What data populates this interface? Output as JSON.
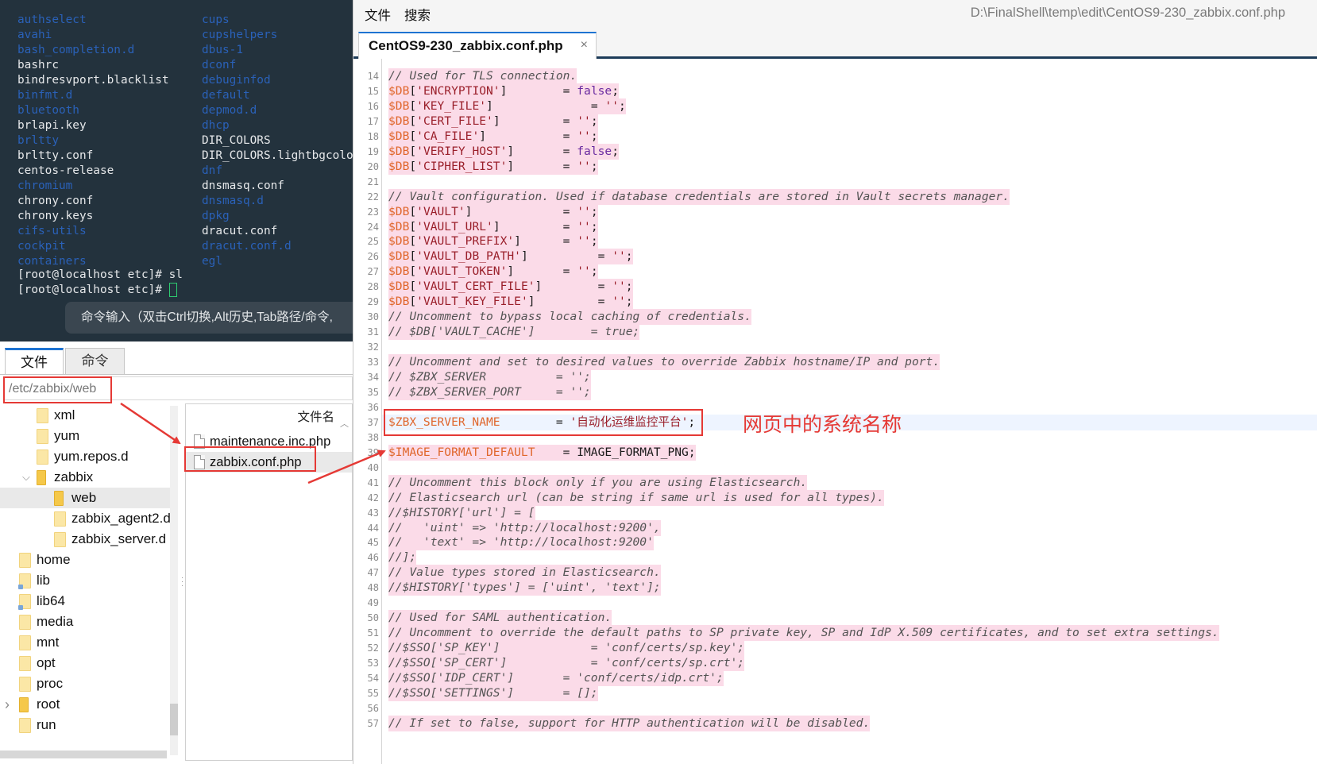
{
  "terminal": {
    "rows": [
      {
        "left": "authselect",
        "left_dir": true,
        "right": "cups",
        "right_dir": true
      },
      {
        "left": "avahi",
        "left_dir": true,
        "right": "cupshelpers",
        "right_dir": true
      },
      {
        "left": "bash_completion.d",
        "left_dir": true,
        "right": "dbus-1",
        "right_dir": true
      },
      {
        "left": "bashrc",
        "left_dir": false,
        "right": "dconf",
        "right_dir": true
      },
      {
        "left": "bindresvport.blacklist",
        "left_dir": false,
        "right": "debuginfod",
        "right_dir": true
      },
      {
        "left": "binfmt.d",
        "left_dir": true,
        "right": "default",
        "right_dir": true
      },
      {
        "left": "bluetooth",
        "left_dir": true,
        "right": "depmod.d",
        "right_dir": true
      },
      {
        "left": "brlapi.key",
        "left_dir": false,
        "right": "dhcp",
        "right_dir": true
      },
      {
        "left": "brltty",
        "left_dir": true,
        "right": "DIR_COLORS",
        "right_dir": false
      },
      {
        "left": "brltty.conf",
        "left_dir": false,
        "right": "DIR_COLORS.lightbgcolor",
        "right_dir": false
      },
      {
        "left": "centos-release",
        "left_dir": false,
        "right": "dnf",
        "right_dir": true
      },
      {
        "left": "chromium",
        "left_dir": true,
        "right": "dnsmasq.conf",
        "right_dir": false
      },
      {
        "left": "chrony.conf",
        "left_dir": false,
        "right": "dnsmasq.d",
        "right_dir": true
      },
      {
        "left": "chrony.keys",
        "left_dir": false,
        "right": "dpkg",
        "right_dir": true
      },
      {
        "left": "cifs-utils",
        "left_dir": true,
        "right": "dracut.conf",
        "right_dir": false
      },
      {
        "left": "cockpit",
        "left_dir": true,
        "right": "dracut.conf.d",
        "right_dir": true
      },
      {
        "left": "containers",
        "left_dir": true,
        "right": "egl",
        "right_dir": true
      }
    ],
    "prompt_lines": [
      "[root@localhost etc]# sl",
      "[root@localhost etc]# "
    ],
    "input_hint": "命令输入（双击Ctrl切换,Alt历史,Tab路径/命令,"
  },
  "file_panel": {
    "tabs": [
      "文件",
      "命令"
    ],
    "path": "/etc/zabbix/web",
    "tree": [
      {
        "label": "xml",
        "depth": 2,
        "expander": "",
        "selected": false,
        "open": false,
        "link": false
      },
      {
        "label": "yum",
        "depth": 2,
        "expander": "",
        "selected": false,
        "open": false,
        "link": false
      },
      {
        "label": "yum.repos.d",
        "depth": 2,
        "expander": "",
        "selected": false,
        "open": false,
        "link": false
      },
      {
        "label": "zabbix",
        "depth": 2,
        "expander": "expanded",
        "selected": false,
        "open": true,
        "link": false
      },
      {
        "label": "web",
        "depth": 3,
        "expander": "",
        "selected": true,
        "open": true,
        "link": false
      },
      {
        "label": "zabbix_agent2.d",
        "depth": 3,
        "expander": "",
        "selected": false,
        "open": false,
        "link": false
      },
      {
        "label": "zabbix_server.d",
        "depth": 3,
        "expander": "",
        "selected": false,
        "open": false,
        "link": false
      },
      {
        "label": "home",
        "depth": 1,
        "expander": "",
        "selected": false,
        "open": false,
        "link": false
      },
      {
        "label": "lib",
        "depth": 1,
        "expander": "",
        "selected": false,
        "open": false,
        "link": true
      },
      {
        "label": "lib64",
        "depth": 1,
        "expander": "",
        "selected": false,
        "open": false,
        "link": true
      },
      {
        "label": "media",
        "depth": 1,
        "expander": "",
        "selected": false,
        "open": false,
        "link": false
      },
      {
        "label": "mnt",
        "depth": 1,
        "expander": "",
        "selected": false,
        "open": false,
        "link": false
      },
      {
        "label": "opt",
        "depth": 1,
        "expander": "",
        "selected": false,
        "open": false,
        "link": false
      },
      {
        "label": "proc",
        "depth": 1,
        "expander": "",
        "selected": false,
        "open": false,
        "link": false
      },
      {
        "label": "root",
        "depth": 1,
        "expander": "collapsed",
        "selected": false,
        "open": true,
        "link": false
      },
      {
        "label": "run",
        "depth": 1,
        "expander": "",
        "selected": false,
        "open": false,
        "link": false
      }
    ],
    "file_list": {
      "header": "文件名",
      "files": [
        {
          "name": "maintenance.inc.php",
          "selected": false
        },
        {
          "name": "zabbix.conf.php",
          "selected": true
        }
      ]
    }
  },
  "editor": {
    "menu": [
      "文件",
      "搜索"
    ],
    "file_path": "D:\\FinalShell\\temp\\edit\\CentOS9-230_zabbix.conf.php",
    "tab_title": "CentOS9-230_zabbix.conf.php",
    "tab_close": "×",
    "annotation": "网页中的系统名称",
    "lines": [
      {
        "n": "14",
        "hl": true,
        "t": [
          [
            "c",
            "// Used for TLS connection."
          ]
        ]
      },
      {
        "n": "15",
        "hl": true,
        "t": [
          [
            "v",
            "$DB"
          ],
          [
            "o",
            "["
          ],
          [
            "s",
            "'ENCRYPTION'"
          ],
          [
            "o",
            "]        = "
          ],
          [
            "k",
            "false"
          ],
          [
            "o",
            ";"
          ]
        ]
      },
      {
        "n": "16",
        "hl": true,
        "t": [
          [
            "v",
            "$DB"
          ],
          [
            "o",
            "["
          ],
          [
            "s",
            "'KEY_FILE'"
          ],
          [
            "o",
            "]              = "
          ],
          [
            "s",
            "''"
          ],
          [
            "o",
            ";"
          ]
        ]
      },
      {
        "n": "17",
        "hl": true,
        "t": [
          [
            "v",
            "$DB"
          ],
          [
            "o",
            "["
          ],
          [
            "s",
            "'CERT_FILE'"
          ],
          [
            "o",
            "]         = "
          ],
          [
            "s",
            "''"
          ],
          [
            "o",
            ";"
          ]
        ]
      },
      {
        "n": "18",
        "hl": true,
        "t": [
          [
            "v",
            "$DB"
          ],
          [
            "o",
            "["
          ],
          [
            "s",
            "'CA_FILE'"
          ],
          [
            "o",
            "]           = "
          ],
          [
            "s",
            "''"
          ],
          [
            "o",
            ";"
          ]
        ]
      },
      {
        "n": "19",
        "hl": true,
        "t": [
          [
            "v",
            "$DB"
          ],
          [
            "o",
            "["
          ],
          [
            "s",
            "'VERIFY_HOST'"
          ],
          [
            "o",
            "]       = "
          ],
          [
            "k",
            "false"
          ],
          [
            "o",
            ";"
          ]
        ]
      },
      {
        "n": "20",
        "hl": true,
        "t": [
          [
            "v",
            "$DB"
          ],
          [
            "o",
            "["
          ],
          [
            "s",
            "'CIPHER_LIST'"
          ],
          [
            "o",
            "]       = "
          ],
          [
            "s",
            "''"
          ],
          [
            "o",
            ";"
          ]
        ]
      },
      {
        "n": "21",
        "hl": false,
        "t": []
      },
      {
        "n": "22",
        "hl": true,
        "t": [
          [
            "c",
            "// Vault configuration. Used if database credentials are stored in Vault secrets manager."
          ]
        ]
      },
      {
        "n": "23",
        "hl": true,
        "t": [
          [
            "v",
            "$DB"
          ],
          [
            "o",
            "["
          ],
          [
            "s",
            "'VAULT'"
          ],
          [
            "o",
            "]             = "
          ],
          [
            "s",
            "''"
          ],
          [
            "o",
            ";"
          ]
        ]
      },
      {
        "n": "24",
        "hl": true,
        "t": [
          [
            "v",
            "$DB"
          ],
          [
            "o",
            "["
          ],
          [
            "s",
            "'VAULT_URL'"
          ],
          [
            "o",
            "]         = "
          ],
          [
            "s",
            "''"
          ],
          [
            "o",
            ";"
          ]
        ]
      },
      {
        "n": "25",
        "hl": true,
        "t": [
          [
            "v",
            "$DB"
          ],
          [
            "o",
            "["
          ],
          [
            "s",
            "'VAULT_PREFIX'"
          ],
          [
            "o",
            "]      = "
          ],
          [
            "s",
            "''"
          ],
          [
            "o",
            ";"
          ]
        ]
      },
      {
        "n": "26",
        "hl": true,
        "t": [
          [
            "v",
            "$DB"
          ],
          [
            "o",
            "["
          ],
          [
            "s",
            "'VAULT_DB_PATH'"
          ],
          [
            "o",
            "]          = "
          ],
          [
            "s",
            "''"
          ],
          [
            "o",
            ";"
          ]
        ]
      },
      {
        "n": "27",
        "hl": true,
        "t": [
          [
            "v",
            "$DB"
          ],
          [
            "o",
            "["
          ],
          [
            "s",
            "'VAULT_TOKEN'"
          ],
          [
            "o",
            "]       = "
          ],
          [
            "s",
            "''"
          ],
          [
            "o",
            ";"
          ]
        ]
      },
      {
        "n": "28",
        "hl": true,
        "t": [
          [
            "v",
            "$DB"
          ],
          [
            "o",
            "["
          ],
          [
            "s",
            "'VAULT_CERT_FILE'"
          ],
          [
            "o",
            "]        = "
          ],
          [
            "s",
            "''"
          ],
          [
            "o",
            ";"
          ]
        ]
      },
      {
        "n": "29",
        "hl": true,
        "t": [
          [
            "v",
            "$DB"
          ],
          [
            "o",
            "["
          ],
          [
            "s",
            "'VAULT_KEY_FILE'"
          ],
          [
            "o",
            "]         = "
          ],
          [
            "s",
            "''"
          ],
          [
            "o",
            ";"
          ]
        ]
      },
      {
        "n": "30",
        "hl": true,
        "t": [
          [
            "c",
            "// Uncomment to bypass local caching of credentials."
          ]
        ]
      },
      {
        "n": "31",
        "hl": true,
        "t": [
          [
            "c",
            "// $DB['VAULT_CACHE']        = true;"
          ]
        ]
      },
      {
        "n": "32",
        "hl": false,
        "t": []
      },
      {
        "n": "33",
        "hl": true,
        "t": [
          [
            "c",
            "// Uncomment and set to desired values to override Zabbix hostname/IP and port."
          ]
        ]
      },
      {
        "n": "34",
        "hl": true,
        "t": [
          [
            "c",
            "// $ZBX_SERVER          = '';"
          ]
        ]
      },
      {
        "n": "35",
        "hl": true,
        "t": [
          [
            "c",
            "// $ZBX_SERVER_PORT     = '';"
          ]
        ]
      },
      {
        "n": "36",
        "hl": false,
        "t": []
      },
      {
        "n": "37",
        "hl": false,
        "cur": true,
        "t": [
          [
            "v",
            "$ZBX_SERVER_NAME"
          ],
          [
            "o",
            "        = "
          ],
          [
            "s",
            "'自动化运维监控平台'"
          ],
          [
            "o",
            ";"
          ]
        ]
      },
      {
        "n": "38",
        "hl": false,
        "t": []
      },
      {
        "n": "39",
        "hl": true,
        "t": [
          [
            "v",
            "$IMAGE_FORMAT_DEFAULT"
          ],
          [
            "o",
            "    = IMAGE_FORMAT_PNG;"
          ]
        ]
      },
      {
        "n": "40",
        "hl": false,
        "t": []
      },
      {
        "n": "41",
        "hl": true,
        "t": [
          [
            "c",
            "// Uncomment this block only if you are using Elasticsearch."
          ]
        ]
      },
      {
        "n": "42",
        "hl": true,
        "t": [
          [
            "c",
            "// Elasticsearch url (can be string if same url is used for all types)."
          ]
        ]
      },
      {
        "n": "43",
        "hl": true,
        "t": [
          [
            "c",
            "//$HISTORY['url'] = ["
          ]
        ]
      },
      {
        "n": "44",
        "hl": true,
        "t": [
          [
            "c",
            "//   'uint' => 'http://localhost:9200',"
          ]
        ]
      },
      {
        "n": "45",
        "hl": true,
        "t": [
          [
            "c",
            "//   'text' => 'http://localhost:9200'"
          ]
        ]
      },
      {
        "n": "46",
        "hl": true,
        "t": [
          [
            "c",
            "//];"
          ]
        ]
      },
      {
        "n": "47",
        "hl": true,
        "t": [
          [
            "c",
            "// Value types stored in Elasticsearch."
          ]
        ]
      },
      {
        "n": "48",
        "hl": true,
        "t": [
          [
            "c",
            "//$HISTORY['types'] = ['uint', 'text'];"
          ]
        ]
      },
      {
        "n": "49",
        "hl": false,
        "t": []
      },
      {
        "n": "50",
        "hl": true,
        "t": [
          [
            "c",
            "// Used for SAML authentication."
          ]
        ]
      },
      {
        "n": "51",
        "hl": true,
        "t": [
          [
            "c",
            "// Uncomment to override the default paths to SP private key, SP and IdP X.509 certificates, and to set extra settings."
          ]
        ]
      },
      {
        "n": "52",
        "hl": true,
        "t": [
          [
            "c",
            "//$SSO['SP_KEY']             = 'conf/certs/sp.key';"
          ]
        ]
      },
      {
        "n": "53",
        "hl": true,
        "t": [
          [
            "c",
            "//$SSO['SP_CERT']            = 'conf/certs/sp.crt';"
          ]
        ]
      },
      {
        "n": "54",
        "hl": true,
        "t": [
          [
            "c",
            "//$SSO['IDP_CERT']       = 'conf/certs/idp.crt';"
          ]
        ]
      },
      {
        "n": "55",
        "hl": true,
        "t": [
          [
            "c",
            "//$SSO['SETTINGS']       = [];"
          ]
        ]
      },
      {
        "n": "56",
        "hl": false,
        "t": []
      },
      {
        "n": "57",
        "hl": true,
        "t": [
          [
            "c",
            "// If set to false, support for HTTP authentication will be disabled."
          ]
        ]
      }
    ]
  },
  "colors": {
    "terminal_bg": "#23323d",
    "dir_blue": "#2a61b8",
    "highlight_red": "#e53935",
    "code_pink_bg": "#fbdbe8",
    "accent_blue": "#1e73d2"
  }
}
